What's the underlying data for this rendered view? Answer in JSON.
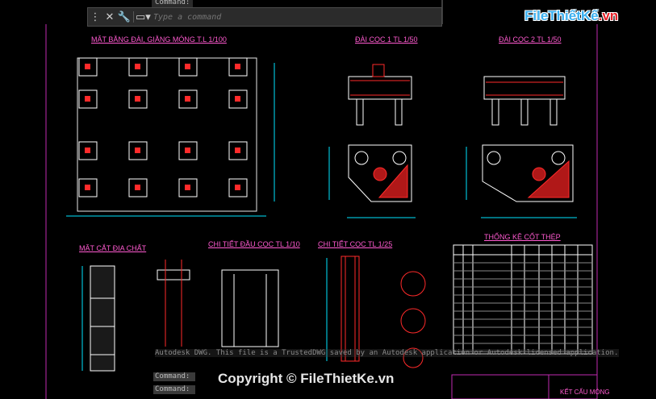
{
  "command_history_top": "Command:",
  "command_input": {
    "placeholder": "Type a command"
  },
  "logo": {
    "text": "FileThiếtKế",
    "suffix": ".vn"
  },
  "drawing_titles": {
    "foundation_plan": "MẶT BẰNG ĐÀI, GIẰNG MÓNG T.L 1/100",
    "pile_cap_1": "ĐÀI CỌC 1 TL 1/50",
    "pile_cap_2": "ĐÀI CỌC 2 TL 1/50",
    "geology": "MẶT CẮT ĐỊA CHẤT",
    "pile_head": "CHI TIẾT ĐẦU CỌC TL 1/10",
    "pile_detail": "CHI TIẾT CỌC TL 1/25",
    "rebar_schedule": "THỐNG KÊ CỐT THÉP",
    "title_block": "KẾT CẤU MÓNG"
  },
  "notice": "Autodesk DWG.  This file is a TrustedDWG saved by an Autodesk application or Autodesk licensed application.",
  "command_lines": [
    "Command:",
    "Command:"
  ],
  "watermark": "Copyright © FileThietKe.vn",
  "colors": {
    "background": "#000000",
    "title": "#ff5ad0",
    "dimension": "#00e5ff",
    "rebar": "#ff2a2a",
    "pile": "#e0e0e0"
  }
}
